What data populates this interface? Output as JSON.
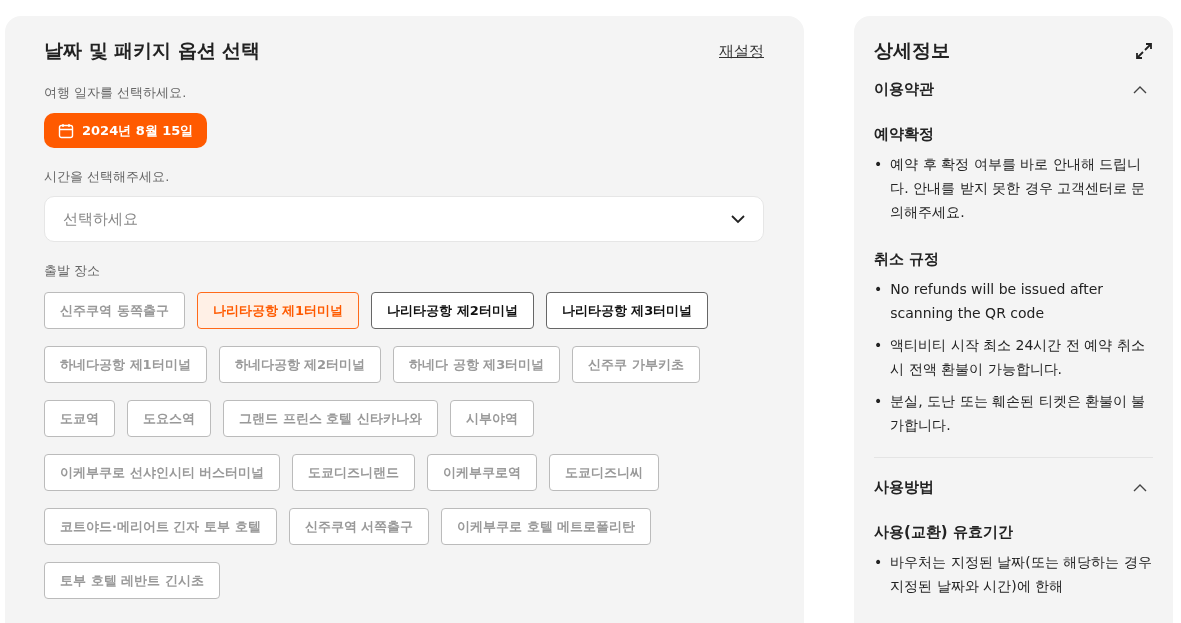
{
  "booking": {
    "title": "날짜 및 패키지 옵션 선택",
    "reset_link": "재설정",
    "date_label": "여행 일자를 선택하세요.",
    "date_button": "2024년 8월 15일",
    "time_label": "시간을 선택해주세요.",
    "time_select": {
      "placeholder": "선택하세요"
    },
    "place_label": "출발 장소",
    "places": [
      {
        "label": "신주쿠역 동쪽출구",
        "selected": false,
        "disabled": true
      },
      {
        "label": "나리타공항 제1터미널",
        "selected": true,
        "disabled": false
      },
      {
        "label": "나리타공항 제2터미널",
        "selected": false,
        "disabled": false
      },
      {
        "label": "나리타공항 제3터미널",
        "selected": false,
        "disabled": false
      },
      {
        "label": "하네다공항 제1터미널",
        "selected": false,
        "disabled": true
      },
      {
        "label": "하네다공항 제2터미널",
        "selected": false,
        "disabled": true
      },
      {
        "label": "하네다 공항 제3터미널",
        "selected": false,
        "disabled": true
      },
      {
        "label": "신주쿠 가부키초",
        "selected": false,
        "disabled": true
      },
      {
        "label": "도쿄역",
        "selected": false,
        "disabled": true
      },
      {
        "label": "도요스역",
        "selected": false,
        "disabled": true
      },
      {
        "label": "그랜드 프린스 호텔 신타카나와",
        "selected": false,
        "disabled": true
      },
      {
        "label": "시부야역",
        "selected": false,
        "disabled": true
      },
      {
        "label": "이케부쿠로 선샤인시티 버스터미널",
        "selected": false,
        "disabled": true
      },
      {
        "label": "도쿄디즈니랜드",
        "selected": false,
        "disabled": true
      },
      {
        "label": "이케부쿠로역",
        "selected": false,
        "disabled": true
      },
      {
        "label": "도쿄디즈니씨",
        "selected": false,
        "disabled": true
      },
      {
        "label": "코트야드·메리어트 긴자 토부 호텔",
        "selected": false,
        "disabled": true
      },
      {
        "label": "신주쿠역 서쪽출구",
        "selected": false,
        "disabled": true
      },
      {
        "label": "이케부쿠로 호텔 메트로폴리탄",
        "selected": false,
        "disabled": true
      },
      {
        "label": "토부 호텔 레반트 긴시초",
        "selected": false,
        "disabled": true
      }
    ]
  },
  "details": {
    "title": "상세정보",
    "sections": [
      {
        "title": "이용약관",
        "expanded": true,
        "groups": [
          {
            "heading": "예약확정",
            "marker": "•",
            "bullets": [
              "예약 후 확정 여부를 바로 안내해 드립니다. 안내를 받지 못한 경우 고객센터로 문의해주세요."
            ]
          },
          {
            "heading": "취소 규정",
            "marker": "•",
            "bullets": [
              "No refunds will be issued after scanning the QR code",
              "액티비티 시작 최소 24시간 전 예약 취소시 전액 환불이 가능합니다.",
              "분실, 도난 또는 훼손된 티켓은 환불이 불가합니다."
            ]
          }
        ]
      },
      {
        "title": "사용방법",
        "expanded": true,
        "groups": [
          {
            "heading": "사용(교환) 유효기간",
            "marker": "•",
            "bullets": [
              "바우처는 지정된 날짜(또는 해당하는 경우 지정된 날짜와 시간)에 한해"
            ]
          }
        ]
      }
    ]
  }
}
